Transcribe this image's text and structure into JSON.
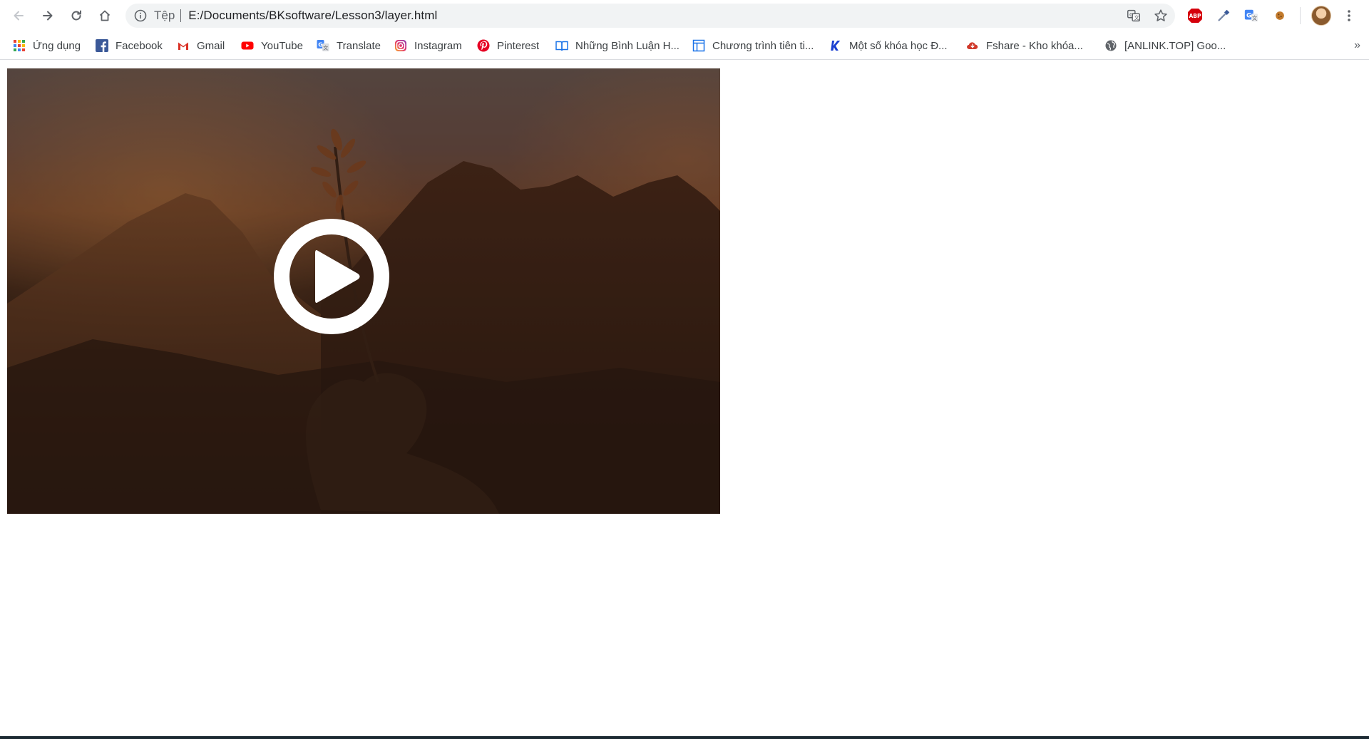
{
  "browser": {
    "omnibox": {
      "scheme_label": "Tệp",
      "url": "E:/Documents/BKsoftware/Lesson3/layer.html"
    },
    "icons": {
      "back": "arrow-left-icon",
      "forward": "arrow-right-icon",
      "reload": "reload-icon",
      "home": "home-icon",
      "info": "info-icon",
      "translate": "translate-icon",
      "bookmark": "star-icon",
      "menu": "kebab-menu-icon"
    },
    "extensions": [
      {
        "name": "adblock-plus-icon",
        "label": "ABP",
        "color": "#d5000c"
      },
      {
        "name": "eyedropper-icon",
        "color": "#3b5b9a"
      },
      {
        "name": "google-translate-icon",
        "color": "#4285f4"
      },
      {
        "name": "cookie-icon",
        "color": "#c27a2c"
      }
    ]
  },
  "bookmarks": {
    "items": [
      {
        "label": "Ứng dụng",
        "icon": "apps-grid-icon"
      },
      {
        "label": "Facebook",
        "icon": "facebook-icon",
        "color": "#3b5998"
      },
      {
        "label": "Gmail",
        "icon": "gmail-icon",
        "color": "#d93025"
      },
      {
        "label": "YouTube",
        "icon": "youtube-icon",
        "color": "#ff0000"
      },
      {
        "label": "Translate",
        "icon": "translate-icon",
        "color": "#4285f4"
      },
      {
        "label": "Instagram",
        "icon": "instagram-icon",
        "color": "#c13584"
      },
      {
        "label": "Pinterest",
        "icon": "pinterest-icon",
        "color": "#e60023"
      },
      {
        "label": "Những Bình Luận H...",
        "icon": "book-icon",
        "color": "#1a73e8"
      },
      {
        "label": "Chương trình tiên ti...",
        "icon": "layout-icon",
        "color": "#1a73e8"
      },
      {
        "label": "Một số khóa học Đ...",
        "icon": "k-logo-icon",
        "color": "#1a3fd1"
      },
      {
        "label": "Fshare - Kho khóa...",
        "icon": "cloud-icon",
        "color": "#d0392b"
      },
      {
        "label": "[ANLINK.TOP] Goo...",
        "icon": "globe-icon",
        "color": "#5f6368"
      }
    ],
    "more": "»"
  },
  "content": {
    "video": {
      "play_icon": "play-circle-icon"
    }
  }
}
